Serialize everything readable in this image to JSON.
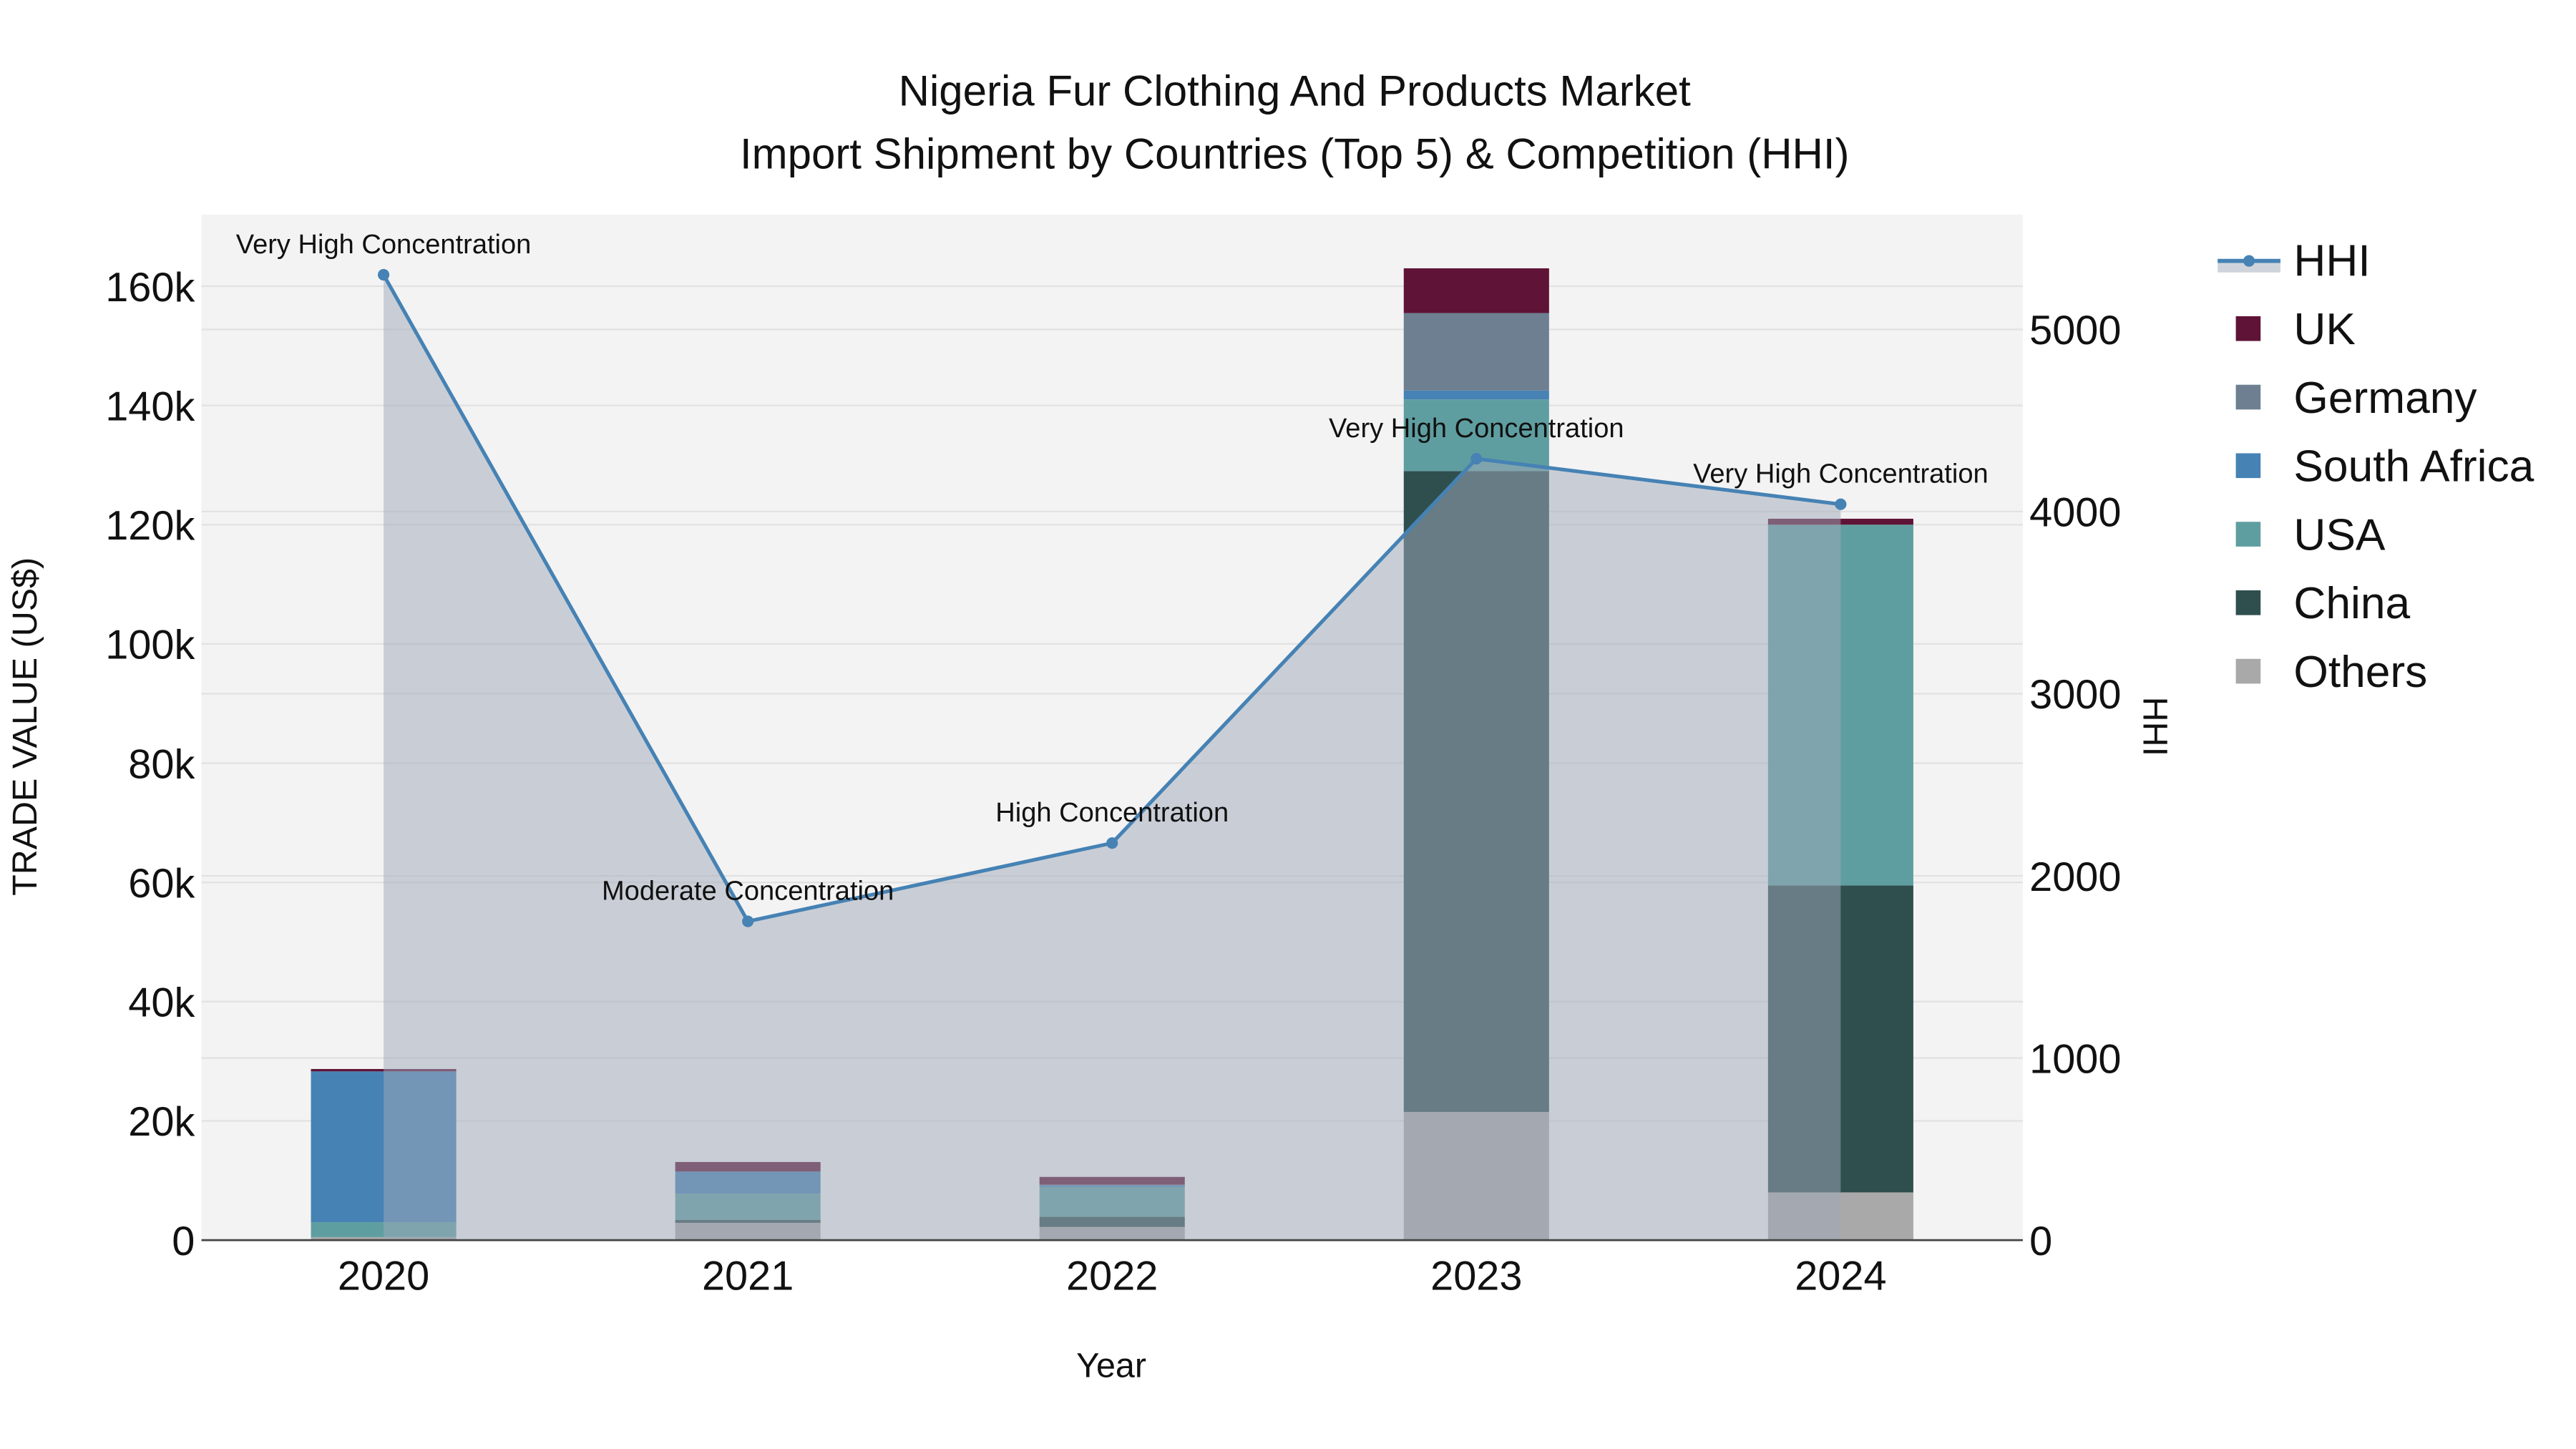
{
  "chart_data": {
    "type": "bar",
    "title": "Nigeria Fur Clothing And Products Market",
    "subtitle": "Import Shipment by Countries (Top 5) & Competition (HHI)",
    "xlabel": "Year",
    "ylabel": "TRADE VALUE (US$)",
    "y2label": "HHI",
    "categories": [
      "2020",
      "2021",
      "2022",
      "2023",
      "2024"
    ],
    "ylim": [
      0,
      172000
    ],
    "y2lim": [
      0,
      5630
    ],
    "yticks": [
      0,
      20000,
      40000,
      60000,
      80000,
      100000,
      120000,
      140000,
      160000
    ],
    "ytick_labels": [
      "0",
      "20k",
      "40k",
      "60k",
      "80k",
      "100k",
      "120k",
      "140k",
      "160k"
    ],
    "y2ticks": [
      0,
      1000,
      2000,
      3000,
      4000,
      5000
    ],
    "y2tick_labels": [
      "0",
      "1000",
      "2000",
      "3000",
      "4000",
      "5000"
    ],
    "stack_order": [
      "Others",
      "China",
      "USA",
      "South Africa",
      "Germany",
      "UK"
    ],
    "series": [
      {
        "name": "UK",
        "color": "#5f1336",
        "values": [
          400,
          1600,
          1300,
          7500,
          1000
        ]
      },
      {
        "name": "Germany",
        "color": "#6e7f91",
        "values": [
          0,
          0,
          100,
          13000,
          0
        ]
      },
      {
        "name": "South Africa",
        "color": "#4682b4",
        "values": [
          25300,
          3700,
          300,
          1500,
          0
        ]
      },
      {
        "name": "USA",
        "color": "#5f9ea0",
        "values": [
          2500,
          4400,
          5000,
          12000,
          60500
        ]
      },
      {
        "name": "China",
        "color": "#2f4f4f",
        "values": [
          0,
          500,
          1700,
          107500,
          51500
        ]
      },
      {
        "name": "Others",
        "color": "#a9a9a9",
        "values": [
          500,
          2900,
          2200,
          21500,
          8000
        ]
      }
    ],
    "hhi": {
      "name": "HHI",
      "color": "#4682b4",
      "values": [
        5300,
        1750,
        2180,
        4290,
        4040
      ],
      "annotations": [
        "Very High Concentration",
        "Moderate Concentration",
        "High Concentration",
        "Very High Concentration",
        "Very High Concentration"
      ]
    },
    "legend_position": "right",
    "legend": [
      "HHI",
      "UK",
      "Germany",
      "South Africa",
      "USA",
      "China",
      "Others"
    ],
    "grid": true
  }
}
